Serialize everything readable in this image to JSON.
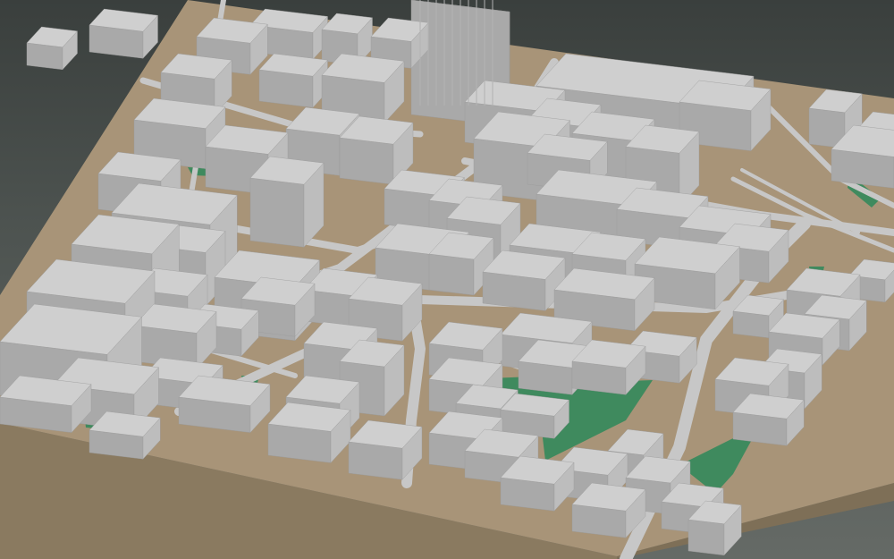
{
  "scene": {
    "kind": "3d-city-block-model",
    "colors": {
      "background_top": "#3a3f3d",
      "background_bottom": "#656a66",
      "ground": "#a89478",
      "base_side": "#9c8a6e",
      "base_front": "#8a7a60",
      "park": "#3f8a5e",
      "building_top": "#cfcfcf",
      "building_left": "#a9a9a9",
      "building_right": "#bdbdbd",
      "road": "#c7c7c7",
      "water": "#7fa8c8"
    }
  }
}
